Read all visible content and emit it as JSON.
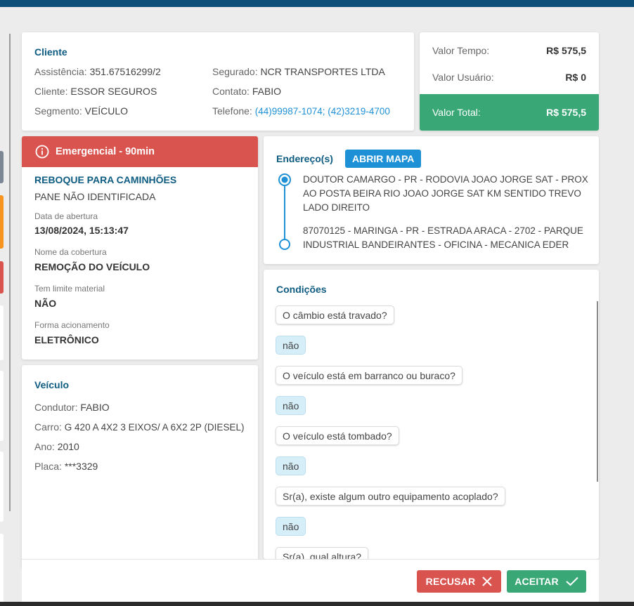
{
  "cliente": {
    "title": "Cliente",
    "assistencia_label": "Assistência:",
    "assistencia_value": "351.67516299/2",
    "cliente_label": "Cliente:",
    "cliente_value": "ESSOR SEGUROS",
    "segmento_label": "Segmento:",
    "segmento_value": "VEÍCULO",
    "segurado_label": "Segurado:",
    "segurado_value": "NCR TRANSPORTES LTDA",
    "contato_label": "Contato:",
    "contato_value": "FABIO",
    "telefone_label": "Telefone:",
    "telefone_value": "(44)99987-1074; (42)3219-4700"
  },
  "valores": {
    "tempo_label": "Valor Tempo:",
    "tempo_value": "R$ 575,5",
    "usuario_label": "Valor Usuário:",
    "usuario_value": "R$ 0",
    "total_label": "Valor Total:",
    "total_value": "R$ 575,5"
  },
  "servico": {
    "badge": "Emergencial - 90min",
    "tipo": "REBOQUE PARA CAMINHÕES",
    "problema": "PANE NÃO IDENTIFICADA",
    "abertura_label": "Data de abertura",
    "abertura_value": "13/08/2024, 15:13:47",
    "cobertura_label": "Nome da cobertura",
    "cobertura_value": "REMOÇÃO DO VEÍCULO",
    "limite_label": "Tem limite material",
    "limite_value": "NÃO",
    "acionamento_label": "Forma acionamento",
    "acionamento_value": "ELETRÔNICO"
  },
  "veiculo": {
    "title": "Veículo",
    "condutor_label": "Condutor:",
    "condutor_value": "FABIO",
    "carro_label": "Carro:",
    "carro_value": "G 420 A 4X2 3 EIXOS/ A 6X2 2P (DIESEL)",
    "ano_label": "Ano:",
    "ano_value": "2010",
    "placa_label": "Placa:",
    "placa_value": "***3329"
  },
  "endereco": {
    "title": "Endereço(s)",
    "map_button": "ABRIR MAPA",
    "origem_line1": "DOUTOR CAMARGO - PR - RODOVIA JOAO JORGE SAT - PROX",
    "origem_line2": "AO POSTA BEIRA RIO JOAO JORGE SAT KM SENTIDO TREVO",
    "origem_line3": "LADO DIREITO",
    "destino_line1": "87070125 - MARINGA - PR - ESTRADA ARACA - 2702 - PARQUE",
    "destino_line2": "INDUSTRIAL BANDEIRANTES - OFICINA - MECANICA EDER"
  },
  "condicoes": {
    "title": "Condições",
    "items": [
      {
        "question": "O câmbio está travado?",
        "answer": "não"
      },
      {
        "question": "O veículo está em barranco ou buraco?",
        "answer": "não"
      },
      {
        "question": "O veículo está tombado?",
        "answer": "não"
      },
      {
        "question": "Sr(a), existe algum outro equipamento acoplado?",
        "answer": "não"
      },
      {
        "question": "Sr(a), qual altura?",
        "answer": ""
      }
    ]
  },
  "actions": {
    "recusar": "RECUSAR",
    "aceitar": "ACEITAR"
  },
  "colors": {
    "primary": "#0f5c82",
    "emergency": "#d9534f",
    "total": "#3aa876",
    "map_button": "#1e90d6",
    "refuse": "#d9534f",
    "accept": "#3aa876"
  },
  "icons": {
    "info": "info-circle-icon",
    "close": "close-icon",
    "check": "check-icon"
  }
}
